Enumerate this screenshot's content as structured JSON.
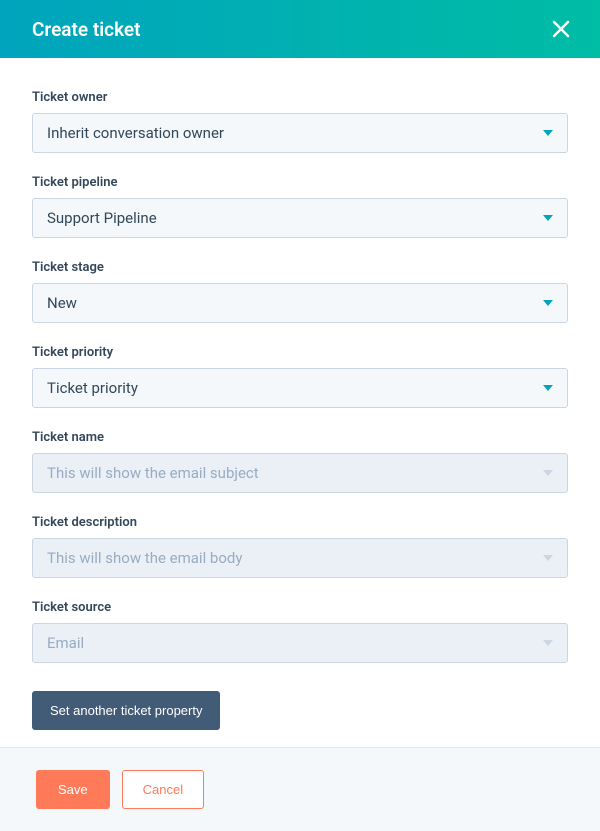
{
  "header": {
    "title": "Create ticket"
  },
  "fields": {
    "owner": {
      "label": "Ticket owner",
      "value": "Inherit conversation owner",
      "disabled": false
    },
    "pipeline": {
      "label": "Ticket pipeline",
      "value": "Support Pipeline",
      "disabled": false
    },
    "stage": {
      "label": "Ticket stage",
      "value": "New",
      "disabled": false
    },
    "priority": {
      "label": "Ticket priority",
      "value": "Ticket priority",
      "disabled": false
    },
    "name": {
      "label": "Ticket name",
      "value": "This will show the email subject",
      "disabled": true
    },
    "description": {
      "label": "Ticket description",
      "value": "This will show the email body",
      "disabled": true
    },
    "source": {
      "label": "Ticket source",
      "value": "Email",
      "disabled": true
    }
  },
  "buttons": {
    "setAnother": "Set another ticket property",
    "save": "Save",
    "cancel": "Cancel"
  }
}
